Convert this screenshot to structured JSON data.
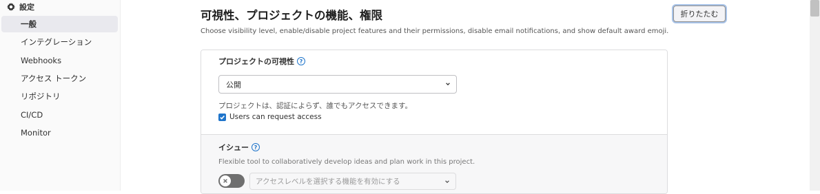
{
  "sidebar": {
    "header": "設定",
    "items": [
      {
        "label": "一般",
        "active": true
      },
      {
        "label": "インテグレーション"
      },
      {
        "label": "Webhooks"
      },
      {
        "label": "アクセス トークン"
      },
      {
        "label": "リポジトリ"
      },
      {
        "label": "CI/CD"
      },
      {
        "label": "Monitor"
      }
    ]
  },
  "section": {
    "title": "可視性、プロジェクトの機能、権限",
    "description": "Choose visibility level, enable/disable project features and their permissions, disable email notifications, and show default award emoji.",
    "collapse_label": "折りたたむ"
  },
  "visibility": {
    "label": "プロジェクトの可視性",
    "help_icon": "help-circle-icon",
    "selected": "公開",
    "help_text": "プロジェクトは、認証によらず、誰でもアクセスできます。",
    "request_access": {
      "label": "Users can request access",
      "checked": true
    }
  },
  "issues": {
    "label": "イシュー",
    "help_icon": "help-circle-icon",
    "description": "Flexible tool to collaboratively develop ideas and plan work in this project.",
    "toggle_on": false,
    "access_placeholder": "アクセスレベルを選択する機能を有効にする"
  },
  "colors": {
    "accent": "#1f75cb",
    "toggle_off": "#6f6f6f"
  }
}
